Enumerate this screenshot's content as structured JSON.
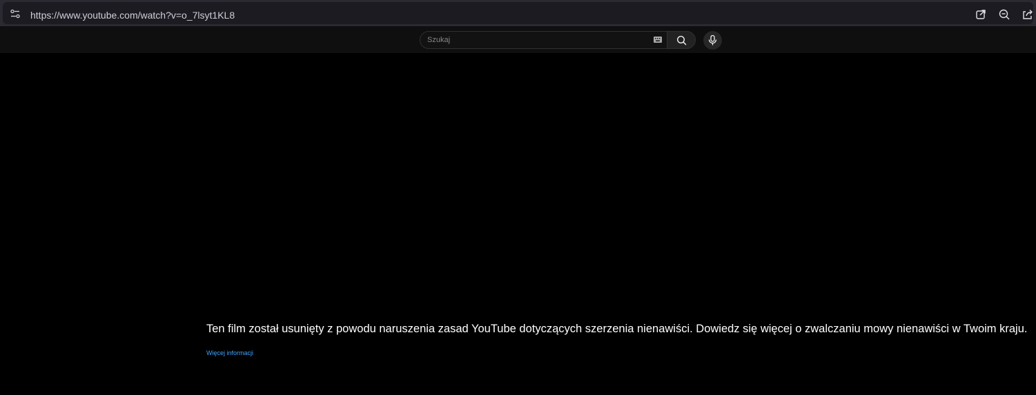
{
  "browser": {
    "url": "https://www.youtube.com/watch?v=o_7lsyt1KL8"
  },
  "header": {
    "search_placeholder": "Szukaj"
  },
  "player": {
    "message": "Ten film został usunięty z powodu naruszenia zasad YouTube dotyczących szerzenia nienawiści. Dowiedz się więcej o zwalczaniu mowy nienawiści w Twoim kraju.",
    "more_link": "Więcej informacji"
  },
  "colors": {
    "background": "#000000",
    "header_bg": "#0f0f0f",
    "browser_bar": "#2b2a33",
    "link": "#3ea6ff"
  },
  "icons": [
    "site-info-icon",
    "open-external-icon",
    "zoom-icon",
    "share-icon",
    "keyboard-icon",
    "search-icon",
    "microphone-icon"
  ]
}
